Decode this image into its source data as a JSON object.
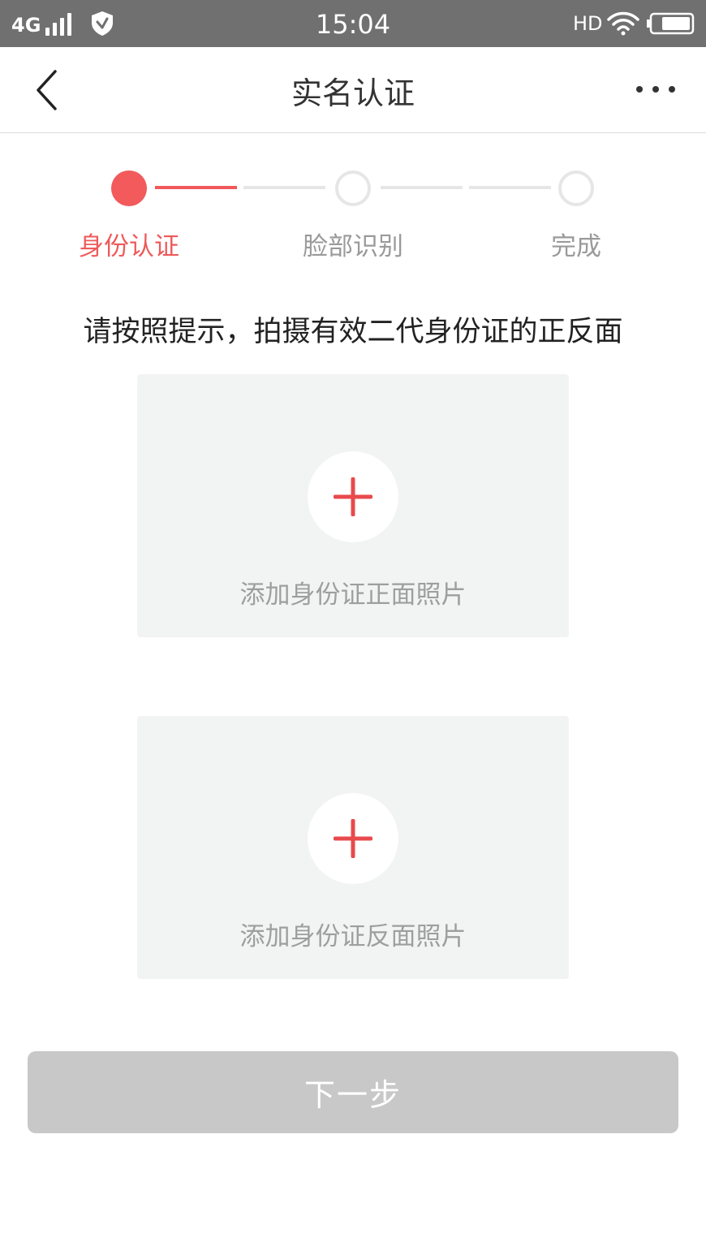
{
  "status_bar": {
    "network": "4G",
    "time": "15:04",
    "hd": "HD"
  },
  "nav": {
    "title": "实名认证"
  },
  "steps": [
    {
      "label": "身份认证",
      "state": "active"
    },
    {
      "label": "脸部识别",
      "state": "inactive"
    },
    {
      "label": "完成",
      "state": "inactive"
    }
  ],
  "instruction": "请按照提示，拍摄有效二代身份证的正反面",
  "upload_cards": [
    {
      "label": "添加身份证正面照片"
    },
    {
      "label": "添加身份证反面照片"
    }
  ],
  "next_button": {
    "label": "下一步"
  },
  "colors": {
    "accent": "#f25a5c",
    "status_bar": "#707070",
    "card_bg": "#f2f3f3",
    "disabled_button": "#c8c8c8"
  }
}
